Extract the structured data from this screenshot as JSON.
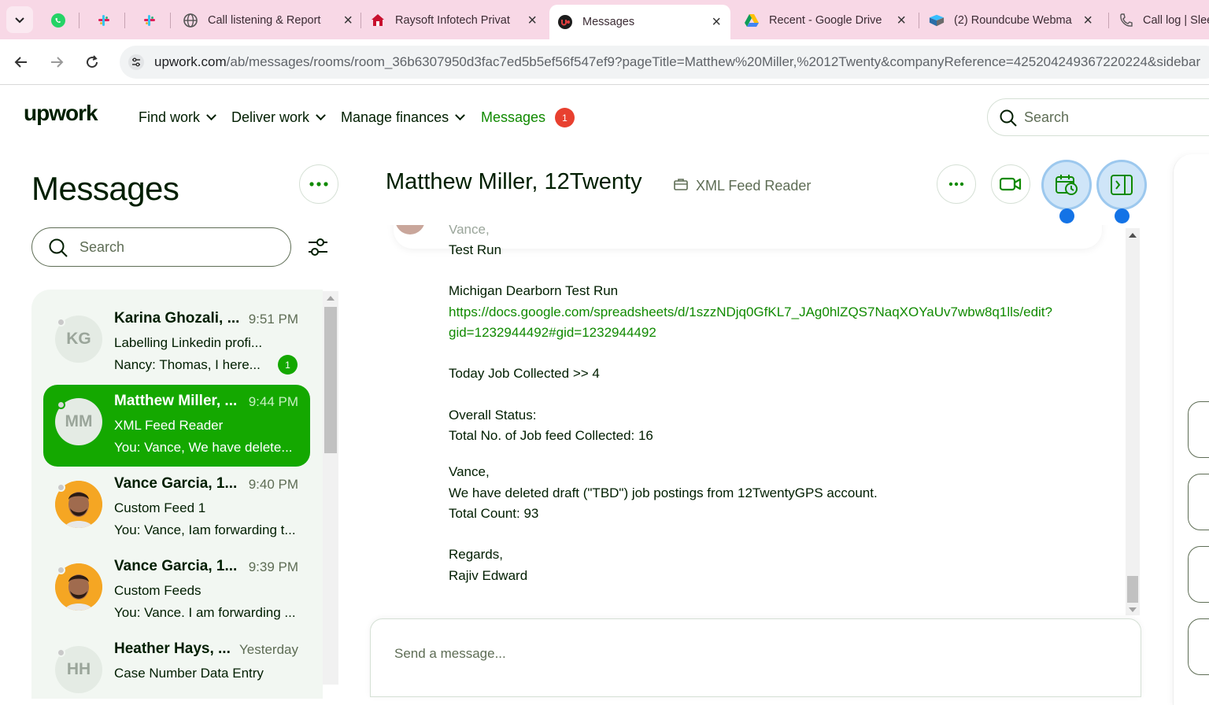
{
  "browser": {
    "tabs": [
      {
        "title": "",
        "icon": "whatsapp-icon",
        "pinned": true
      },
      {
        "title": "",
        "icon": "slack-icon",
        "pinned": true
      },
      {
        "title": "",
        "icon": "slack-icon",
        "pinned": true
      },
      {
        "title": "Call listening & Report",
        "icon": "globe-icon",
        "pinned": false
      },
      {
        "title": "Raysoft Infotech Privat",
        "icon": "raysoft-icon",
        "pinned": false
      },
      {
        "title": "Messages",
        "icon": "upwork-favicon",
        "pinned": false,
        "active": true
      },
      {
        "title": "Recent - Google Drive",
        "icon": "google-drive-icon",
        "pinned": false
      },
      {
        "title": "(2) Roundcube Webma",
        "icon": "roundcube-icon",
        "pinned": false
      },
      {
        "title": "Call log | Slee",
        "icon": "phone-icon",
        "pinned": false
      }
    ],
    "url_host": "upwork.com",
    "url_path": "/ab/messages/rooms/room_36b6307950d3fac7ed5b5ef56f547ef9?pageTitle=Matthew%20Miller,%2012Twenty&companyReference=425204249367220224&sidebar"
  },
  "header": {
    "logo": "upwork",
    "nav": {
      "find_work": "Find work",
      "deliver_work": "Deliver work",
      "manage_finances": "Manage finances",
      "messages": "Messages"
    },
    "messages_badge": "1",
    "search_placeholder": "Search"
  },
  "sidebar": {
    "title": "Messages",
    "search_placeholder": "Search",
    "rooms": [
      {
        "initials": "KG",
        "name": "Karina Ghozali, ...",
        "time": "9:51 PM",
        "subtitle": "Labelling Linkedin profi...",
        "preview": "Nancy: Thomas, I here...",
        "unread": "1",
        "active": false,
        "photo": false
      },
      {
        "initials": "MM",
        "name": "Matthew Miller, ...",
        "time": "9:44 PM",
        "subtitle": "XML Feed Reader",
        "preview": "You: Vance, We have delete...",
        "unread": "",
        "active": true,
        "photo": false
      },
      {
        "initials": "",
        "name": "Vance Garcia, 1...",
        "time": "9:40 PM",
        "subtitle": "Custom Feed 1",
        "preview": "You: Vance, Iam forwarding t...",
        "unread": "",
        "active": false,
        "photo": true
      },
      {
        "initials": "",
        "name": "Vance Garcia, 1...",
        "time": "9:39 PM",
        "subtitle": "Custom Feeds",
        "preview": "You: Vance. I am forwarding ...",
        "unread": "",
        "active": false,
        "photo": true
      },
      {
        "initials": "HH",
        "name": "Heather Hays, ...",
        "time": "Yesterday",
        "subtitle": "Case Number Data Entry",
        "preview": "",
        "unread": "",
        "active": false,
        "photo": false
      }
    ]
  },
  "chat": {
    "title": "Matthew Miller, 12Twenty",
    "contract": "XML Feed Reader",
    "lines": {
      "peek": "Vance,",
      "test_run": "Test Run",
      "michigan": "Michigan Dearborn Test Run",
      "link_1": "https://docs.google.com/spreadsheets/d/1szzNDjq0GfKL7_JAg0hlZQS7NaqXOYaUv7wbw8q1lls/edit?",
      "link_2": "gid=1232944492#gid=1232944492",
      "today": "Today Job Collected >> 4",
      "overall": "Overall Status:",
      "total_feed": "Total No. of Job feed Collected: 16",
      "vance": "Vance,",
      "deleted": "We have deleted draft (\"TBD\") job postings from 12TwentyGPS account.",
      "total_count": "Total Count: 93",
      "regards": "Regards,",
      "signature": "Rajiv Edward"
    },
    "composer_placeholder": "Send a message..."
  },
  "colors": {
    "brand_green": "#14a800",
    "link_green": "#108a00",
    "badge_red": "#e8402f",
    "tab_strip_pink": "#f8d8e6",
    "highlight_blue": "#1473e6"
  }
}
